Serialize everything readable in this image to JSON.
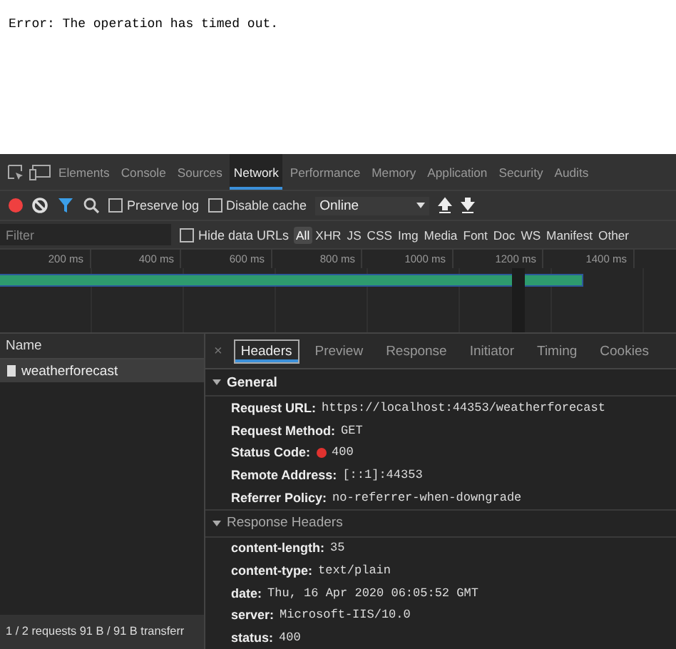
{
  "page": {
    "message": "Error: The operation has timed out."
  },
  "devtools_tabs": [
    {
      "label": "Elements",
      "selected": false
    },
    {
      "label": "Console",
      "selected": false
    },
    {
      "label": "Sources",
      "selected": false
    },
    {
      "label": "Network",
      "selected": true
    },
    {
      "label": "Performance",
      "selected": false
    },
    {
      "label": "Memory",
      "selected": false
    },
    {
      "label": "Application",
      "selected": false
    },
    {
      "label": "Security",
      "selected": false
    },
    {
      "label": "Audits",
      "selected": false
    }
  ],
  "toolbar": {
    "recording": true,
    "filter_on": true,
    "preserve_log": {
      "label": "Preserve log",
      "checked": false
    },
    "disable_cache": {
      "label": "Disable cache",
      "checked": false
    },
    "throttling": "Online"
  },
  "filter_bar": {
    "placeholder": "Filter",
    "hide_data_urls": {
      "label": "Hide data URLs",
      "checked": false
    },
    "types": [
      {
        "label": "All",
        "selected": true
      },
      {
        "label": "XHR",
        "selected": false
      },
      {
        "label": "JS",
        "selected": false
      },
      {
        "label": "CSS",
        "selected": false
      },
      {
        "label": "Img",
        "selected": false
      },
      {
        "label": "Media",
        "selected": false
      },
      {
        "label": "Font",
        "selected": false
      },
      {
        "label": "Doc",
        "selected": false
      },
      {
        "label": "WS",
        "selected": false
      },
      {
        "label": "Manifest",
        "selected": false
      },
      {
        "label": "Other",
        "selected": false
      }
    ]
  },
  "timeline": {
    "ticks": [
      "200 ms",
      "400 ms",
      "600 ms",
      "800 ms",
      "1000 ms",
      "1200 ms",
      "1400 ms"
    ]
  },
  "requests": {
    "column": "Name",
    "rows": [
      {
        "name": "weatherforecast",
        "selected": true
      }
    ],
    "status": "1 / 2 requests  91 B / 91 B transferr"
  },
  "detail_close": "×",
  "detail_tabs": [
    {
      "label": "Headers",
      "selected": true
    },
    {
      "label": "Preview",
      "selected": false
    },
    {
      "label": "Response",
      "selected": false
    },
    {
      "label": "Initiator",
      "selected": false
    },
    {
      "label": "Timing",
      "selected": false
    },
    {
      "label": "Cookies",
      "selected": false
    }
  ],
  "sections": [
    {
      "title": "General",
      "expanded": true,
      "rows": [
        {
          "key": "Request URL:",
          "value": "https://localhost:44353/weatherforecast"
        },
        {
          "key": "Request Method:",
          "value": "GET"
        },
        {
          "key": "Status Code:",
          "value": "400",
          "kind": "status",
          "color": "#e0322f"
        },
        {
          "key": "Remote Address:",
          "value": "[::1]:44353"
        },
        {
          "key": "Referrer Policy:",
          "value": "no-referrer-when-downgrade"
        }
      ]
    },
    {
      "title": "Response Headers",
      "expanded": true,
      "rows": [
        {
          "key": "content-length:",
          "value": "35"
        },
        {
          "key": "content-type:",
          "value": "text/plain"
        },
        {
          "key": "date:",
          "value": "Thu, 16 Apr 2020 06:05:52 GMT"
        },
        {
          "key": "server:",
          "value": "Microsoft-IIS/10.0"
        },
        {
          "key": "status:",
          "value": "400"
        }
      ]
    }
  ]
}
